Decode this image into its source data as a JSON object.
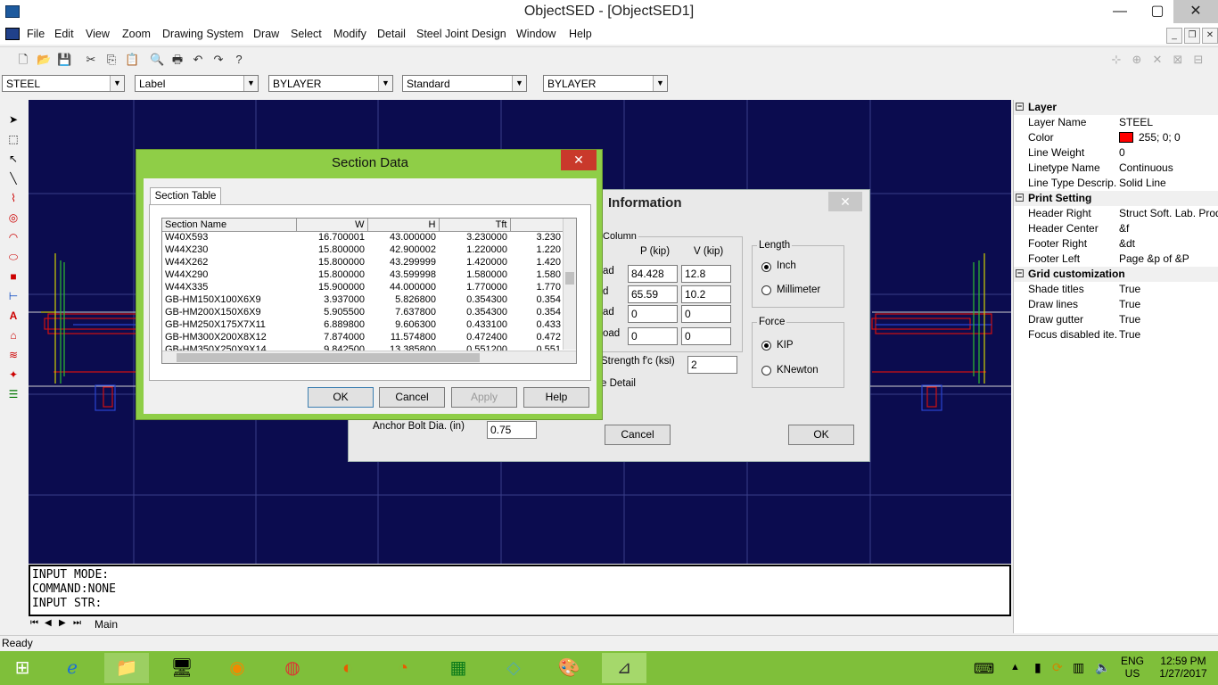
{
  "window": {
    "title": "ObjectSED - [ObjectSED1]",
    "min": "—",
    "max": "▢",
    "close": "✕"
  },
  "menu": [
    "File",
    "Edit",
    "View",
    "Zoom",
    "Drawing System",
    "Draw",
    "Select",
    "Modify",
    "Detail",
    "Steel Joint Design",
    "Window",
    "Help"
  ],
  "combos": {
    "layer": "STEEL",
    "label": "Label",
    "linetype": "BYLAYER",
    "style": "Standard",
    "color": "BYLAYER"
  },
  "command": {
    "line1": "INPUT MODE:",
    "line2": "COMMAND:NONE",
    "line3": "INPUT STR:"
  },
  "tabs": {
    "main": "Main"
  },
  "status": {
    "text": "Ready"
  },
  "properties": {
    "layer": {
      "title": "Layer",
      "rows": [
        {
          "k": "Layer Name",
          "v": "STEEL"
        },
        {
          "k": "Color",
          "v": "255; 0; 0"
        },
        {
          "k": "Line Weight",
          "v": "0"
        },
        {
          "k": "Linetype Name",
          "v": "Continuous"
        },
        {
          "k": "Line Type Descrip...",
          "v": "Solid Line"
        }
      ]
    },
    "print": {
      "title": "Print Setting",
      "rows": [
        {
          "k": "Header Right",
          "v": "Struct Soft. Lab. Prod..."
        },
        {
          "k": "Header Center",
          "v": "&f"
        },
        {
          "k": "Footer Right",
          "v": "&dt"
        },
        {
          "k": "Footer Left",
          "v": "Page &p of &P"
        }
      ]
    },
    "grid": {
      "title": "Grid customization",
      "rows": [
        {
          "k": "Shade titles",
          "v": "True"
        },
        {
          "k": "Draw lines",
          "v": "True"
        },
        {
          "k": "Draw gutter",
          "v": "True"
        },
        {
          "k": "Focus disabled ite...",
          "v": "True"
        }
      ]
    },
    "color_swatch": "#ff0000"
  },
  "info_dialog": {
    "title": "Information",
    "column_group": "Column",
    "col_p": "P (kip)",
    "col_v": "V (kip)",
    "row_labels": [
      "ad",
      "d",
      "ad",
      "oad"
    ],
    "rows": [
      {
        "p": "84.428",
        "v": "12.8"
      },
      {
        "p": "65.59",
        "v": "10.2"
      },
      {
        "p": "0",
        "v": "0"
      },
      {
        "p": "0",
        "v": "0"
      }
    ],
    "length_group": "Length",
    "length_opts": [
      "Inch",
      "Millimeter"
    ],
    "force_group": "Force",
    "force_opts": [
      "KIP",
      "KNewton"
    ],
    "strength_label": "Strength f'c (ksi)",
    "strength_value": "2",
    "detail_label": "e Detail",
    "anchor_label": "Anchor Bolt Dia. (in)",
    "anchor_value": "0.75",
    "cancel": "Cancel",
    "ok": "OK"
  },
  "section_dialog": {
    "title": "Section Data",
    "tab": "Section Table",
    "headers": [
      "Section Name",
      "W",
      "H",
      "Tft",
      ""
    ],
    "rows": [
      [
        "W40X593",
        "16.700001",
        "43.000000",
        "3.230000",
        "3.230"
      ],
      [
        "W44X230",
        "15.800000",
        "42.900002",
        "1.220000",
        "1.220"
      ],
      [
        "W44X262",
        "15.800000",
        "43.299999",
        "1.420000",
        "1.420"
      ],
      [
        "W44X290",
        "15.800000",
        "43.599998",
        "1.580000",
        "1.580"
      ],
      [
        "W44X335",
        "15.900000",
        "44.000000",
        "1.770000",
        "1.770"
      ],
      [
        "GB-HM150X100X6X9",
        "3.937000",
        "5.826800",
        "0.354300",
        "0.354"
      ],
      [
        "GB-HM200X150X6X9",
        "5.905500",
        "7.637800",
        "0.354300",
        "0.354"
      ],
      [
        "GB-HM250X175X7X11",
        "6.889800",
        "9.606300",
        "0.433100",
        "0.433"
      ],
      [
        "GB-HM300X200X8X12",
        "7.874000",
        "11.574800",
        "0.472400",
        "0.472"
      ],
      [
        "GB-HM350X250X9X14",
        "9.842500",
        "13.385800",
        "0.551200",
        "0.551"
      ]
    ],
    "ok": "OK",
    "cancel": "Cancel",
    "apply": "Apply",
    "help": "Help",
    "close": "✕"
  },
  "tray": {
    "lang": "ENG",
    "region": "US",
    "time": "12:59 PM",
    "date": "1/27/2017"
  }
}
